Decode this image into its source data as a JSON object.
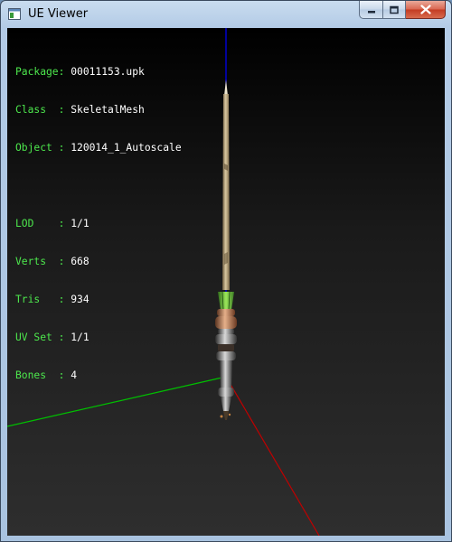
{
  "window": {
    "title": "UE Viewer"
  },
  "info": {
    "rows_top": [
      {
        "label": "Package: ",
        "value": "00011153.upk"
      },
      {
        "label": "Class  : ",
        "value": "SkeletalMesh"
      },
      {
        "label": "Object : ",
        "value": "120014_1_Autoscale"
      }
    ],
    "rows_stats": [
      {
        "label": "LOD    : ",
        "value": "1/1"
      },
      {
        "label": "Verts  : ",
        "value": "668"
      },
      {
        "label": "Tris   : ",
        "value": "934"
      },
      {
        "label": "UV Set : ",
        "value": "1/1"
      },
      {
        "label": "Bones  : ",
        "value": "4"
      }
    ]
  },
  "colors": {
    "label_green": "#4de84d",
    "axis_x": "#c00000",
    "axis_y": "#00c000",
    "axis_z": "#0000ff"
  },
  "icons": [
    "app-icon",
    "minimize-icon",
    "maximize-icon",
    "close-icon"
  ]
}
